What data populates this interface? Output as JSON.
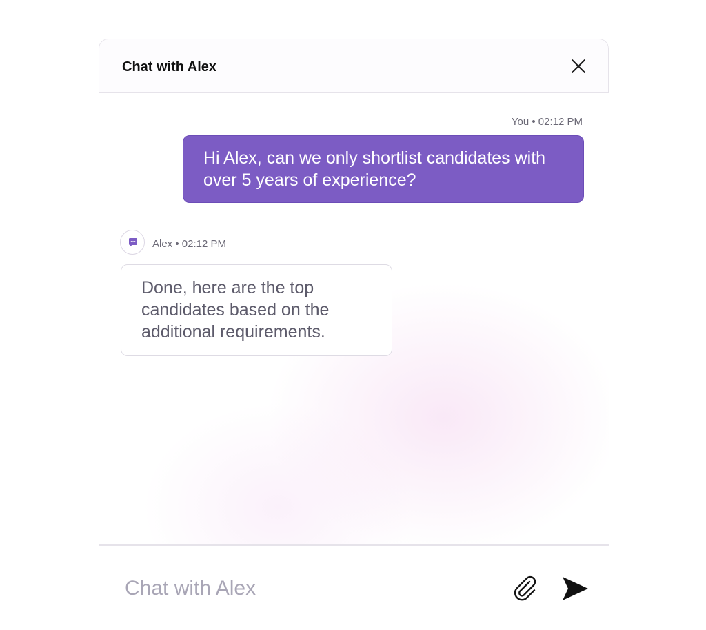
{
  "header": {
    "title": "Chat with Alex",
    "close_icon": "close-icon"
  },
  "messages": [
    {
      "sender": "You",
      "time": "02:12 PM",
      "meta": "You • 02:12 PM",
      "text": "Hi Alex, can we only shortlist candidates with over 5 years of experience?"
    },
    {
      "sender": "Alex",
      "time": "02:12 PM",
      "meta": "Alex • 02:12 PM",
      "text": "Done, here are the top candidates based on the additional requirements.",
      "avatar_icon": "chat-bubble-icon"
    }
  ],
  "composer": {
    "placeholder": "Chat with Alex",
    "value": "",
    "attach_icon": "paperclip-icon",
    "send_icon": "send-icon"
  },
  "colors": {
    "accent": "#7c5cc4",
    "user_bubble_text": "#ffffff",
    "assistant_text": "#5d5b6b",
    "meta_text": "#6b6976",
    "placeholder": "#a9a6b6"
  }
}
